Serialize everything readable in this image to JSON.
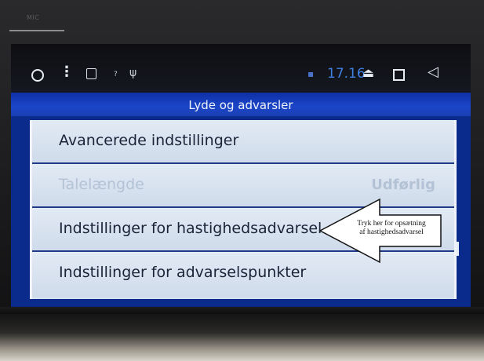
{
  "device": {
    "mic_label": "MIC"
  },
  "statusbar": {
    "time": "17.16",
    "question_mark": "?",
    "usb_glyph": "ψ"
  },
  "screen": {
    "title": "Lyde og advarsler"
  },
  "list": {
    "items": [
      {
        "label": "Avancerede indstillinger",
        "value": "",
        "enabled": true
      },
      {
        "label": "Talelængde",
        "value": "Udførlig",
        "enabled": false
      },
      {
        "label": "Indstillinger for hastighedsadvarsel",
        "value": "",
        "enabled": true
      },
      {
        "label": "Indstillinger for advarselspunkter",
        "value": "",
        "enabled": true
      }
    ]
  },
  "annotation": {
    "line1": "Tryk her for opsætning",
    "line2": "af hastighedsadvarsel"
  },
  "colors": {
    "accent_blue": "#1c46c8",
    "time_blue": "#3f7fe0",
    "list_bg": "#d8e2ef"
  },
  "icons": [
    "home-circle-icon",
    "more-vert-icon",
    "sd-card-icon",
    "usb-icon",
    "eject-icon",
    "recent-apps-icon",
    "back-icon"
  ]
}
